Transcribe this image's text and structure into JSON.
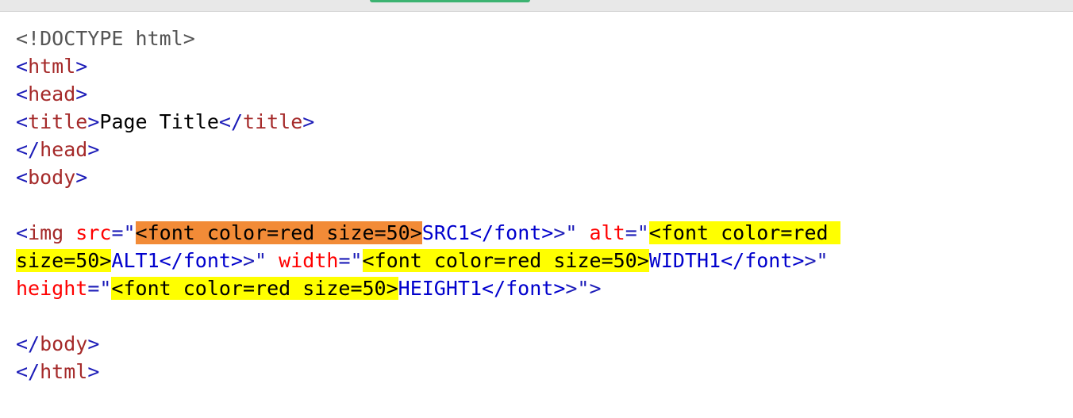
{
  "colors": {
    "tab_accent": "#3cb371",
    "selection_highlight": "#f28b37",
    "match_highlight": "#ffff00",
    "tag_bracket": "#1c1cb8",
    "tag_name": "#a52a2a",
    "attr_name": "#ff0000",
    "attr_value": "#0000cd"
  },
  "code": {
    "doctype": "<!DOCTYPE html>",
    "open_html": "html",
    "open_head": "head",
    "title_tag": "title",
    "title_text": "Page Title",
    "close_head": "head",
    "open_body": "body",
    "img_tag": "img",
    "attr_src": "src",
    "attr_alt": "alt",
    "attr_width": "width",
    "attr_height": "height",
    "injected_font_tag": "<font color=red size=50>",
    "injected_font_tag_part1": "<font color=red ",
    "injected_font_tag_part2": "size=50>",
    "src_value": "SRC1</font>",
    "alt_value": "ALT1</font>",
    "width_value": "WIDTH1</font>",
    "height_value": "HEIGHT1</font>",
    "close_body": "body",
    "close_html": "html"
  }
}
